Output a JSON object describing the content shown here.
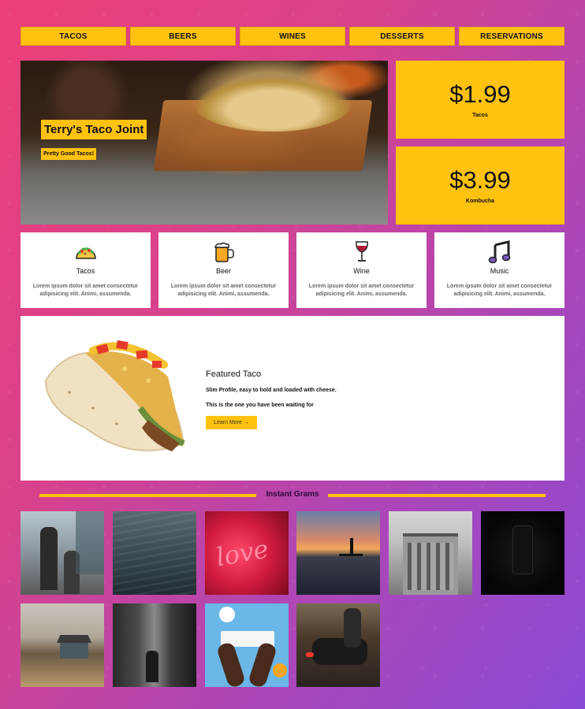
{
  "nav": {
    "items": [
      "TACOS",
      "BEERS",
      "WINES",
      "DESSERTS",
      "RESERVATIONS"
    ]
  },
  "hero": {
    "title": "Terry's Taco Joint",
    "subtitle": "Pretty Good Tacos!"
  },
  "prices": [
    {
      "amount": "$1.99",
      "label": "Tacos"
    },
    {
      "amount": "$3.99",
      "label": "Kombucha"
    }
  ],
  "cards": [
    {
      "title": "Tacos",
      "text": "Lorem ipsum dolor sit amet consectetur adipisicing elit. Animi, assumenda.",
      "icon": "taco-icon"
    },
    {
      "title": "Beer",
      "text": "Lorem ipsum dolor sit amet consectetur adipisicing elit. Animi, assumenda.",
      "icon": "beer-mug-icon"
    },
    {
      "title": "Wine",
      "text": "Lorem ipsum dolor sit amet consectetur adipisicing elit. Animi, assumenda.",
      "icon": "wine-glass-icon"
    },
    {
      "title": "Music",
      "text": "Lorem ipsum dolor sit amet consectetur adipisicing elit. Animi, assumenda.",
      "icon": "music-notes-icon"
    }
  ],
  "featured": {
    "title": "Featured Taco",
    "line1": "Slim Profile, easy to hold and loaded with cheese.",
    "line2": "This is the one you have been waiting for",
    "button": "Learn More →"
  },
  "grams": {
    "heading": "Instant Grams"
  },
  "colors": {
    "accent": "#ffc20e",
    "bg_start": "#ec3f78",
    "bg_end": "#8a4ad6"
  }
}
